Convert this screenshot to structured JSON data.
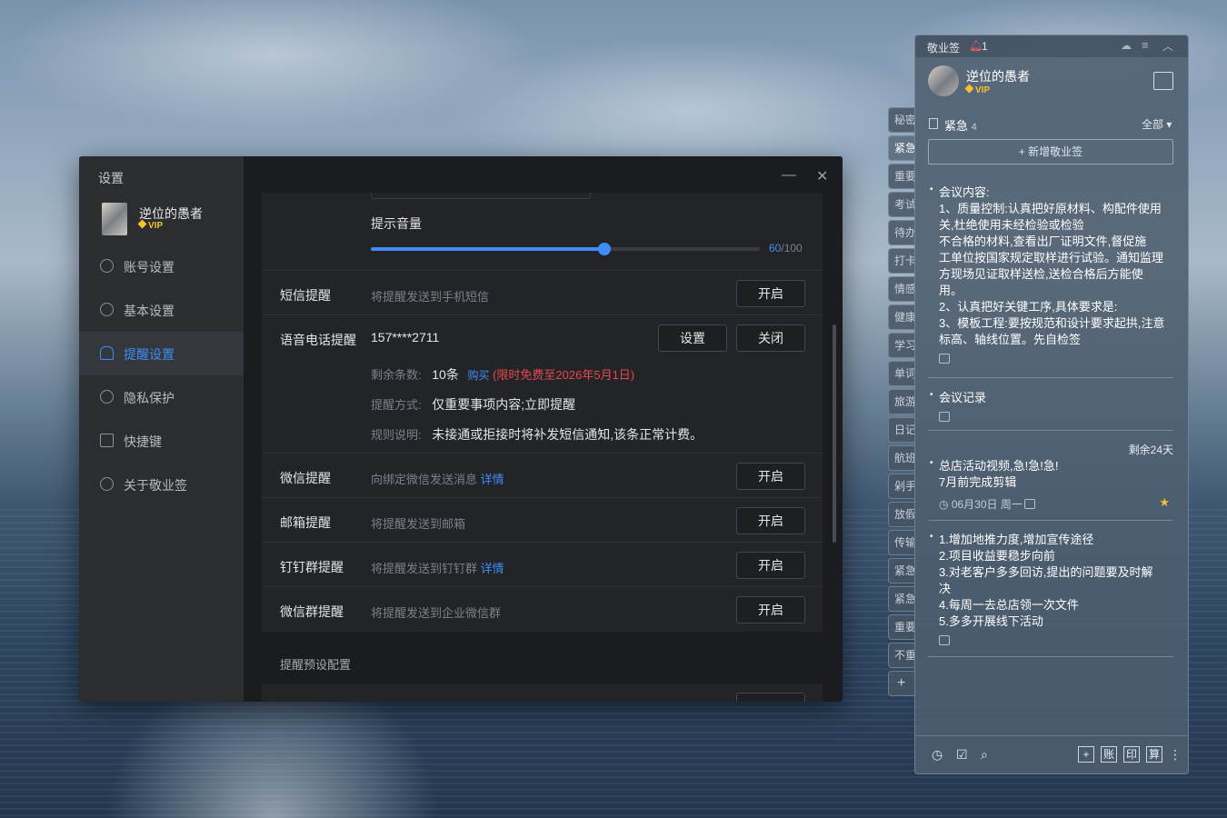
{
  "settings": {
    "title": "设置",
    "user": {
      "name": "逆位的愚者",
      "vip": "VIP"
    },
    "nav": [
      {
        "label": "账号设置"
      },
      {
        "label": "基本设置"
      },
      {
        "label": "提醒设置"
      },
      {
        "label": "隐私保护"
      },
      {
        "label": "快捷键"
      },
      {
        "label": "关于敬业签"
      }
    ],
    "volume": {
      "label": "提示音量",
      "value": 60,
      "max": 100,
      "value_text": "60",
      "max_text": "/100"
    },
    "sms": {
      "label": "短信提醒",
      "desc": "将提醒发送到手机短信",
      "button": "开启"
    },
    "voice": {
      "label": "语音电话提醒",
      "phone": "157****2711",
      "set_button": "设置",
      "close_button": "关闭",
      "remain_label": "剩余条数:",
      "remain_value": "10条",
      "buy": "购买",
      "free_note": "(限时免费至2026年5月1日)",
      "mode_label": "提醒方式:",
      "mode_value": "仅重要事项内容;立即提醒",
      "rule_label": "规则说明:",
      "rule_value": "未接通或拒接时将补发短信通知,该条正常计费。"
    },
    "wechat": {
      "label": "微信提醒",
      "desc": "向绑定微信发送消息",
      "link": "详情",
      "button": "开启"
    },
    "email": {
      "label": "邮箱提醒",
      "desc": "将提醒发送到邮箱",
      "button": "开启"
    },
    "dingtalk": {
      "label": "钉钉群提醒",
      "desc": "将提醒发送到钉钉群",
      "link": "详情",
      "button": "开启"
    },
    "wecom": {
      "label": "微信群提醒",
      "desc": "将提醒发送到企业微信群",
      "button": "开启"
    },
    "preset_title": "提醒预设配置"
  },
  "notes": {
    "app_name": "敬业签",
    "badge": "1",
    "user": {
      "name": "逆位的愚者",
      "vip": "VIP"
    },
    "category": {
      "name": "紧急",
      "count": "4",
      "filter": "全部"
    },
    "add_button": "+ 新增敬业签",
    "tabs": [
      "秘密",
      "紧急",
      "重要",
      "考试",
      "待办",
      "打卡",
      "情感",
      "健康",
      "学习",
      "单词",
      "旅游",
      "日记",
      "航班",
      "剁手",
      "放假",
      "传输",
      "紧急",
      "紧急",
      "重要",
      "不重"
    ],
    "items": [
      {
        "lines": [
          "会议内容:",
          "1、质量控制:认真把好原材料、构配件使用",
          "关,杜绝使用未经检验或检验",
          "不合格的材料,查看出厂证明文件,督促施",
          "工单位按国家规定取样进行试验。通知监理",
          "方现场见证取样送检,送检合格后方能使",
          "用。",
          "2、认真把好关键工序,具体要求是:",
          "3、模板工程:要按规范和设计要求起拱,注意",
          "标高、轴线位置。先自检签"
        ]
      },
      {
        "lines": [
          "会议记录"
        ]
      },
      {
        "remain": "剩余24天",
        "lines": [
          "总店活动视频,急!急!急!",
          "7月前完成剪辑"
        ],
        "date": "06月30日 周一"
      },
      {
        "lines": [
          "1.增加地推力度,增加宣传途径",
          "2.项目收益要稳步向前",
          "3.对老客户多多回访,提出的问题要及时解",
          "决",
          "4.每周一去总店领一次文件",
          "5.多多开展线下活动"
        ]
      }
    ],
    "footer_right": [
      "+",
      "账",
      "印",
      "算"
    ]
  },
  "colors": {
    "accent": "#3e8ef7",
    "warn": "#e5484d",
    "vip": "#f2c230"
  }
}
